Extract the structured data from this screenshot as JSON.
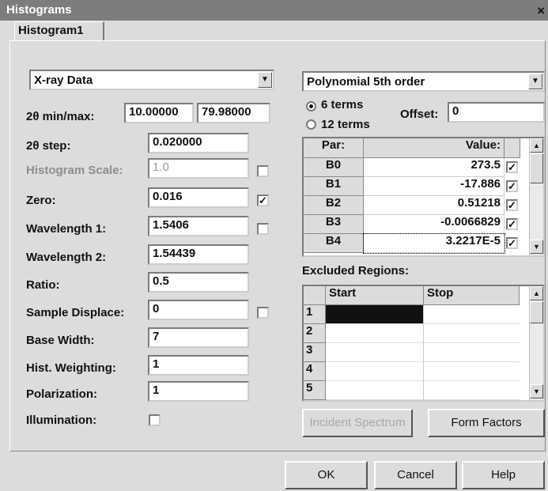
{
  "window": {
    "title": "Histograms",
    "close": "×"
  },
  "tabs": [
    "Histogram1"
  ],
  "data_type": {
    "value": "X-ray Data"
  },
  "background": {
    "value": "Polynomial 5th order"
  },
  "terms": {
    "opt1": "6 terms",
    "opt2": "12 terms",
    "selected": "6 terms"
  },
  "offset": {
    "label": "Offset:",
    "value": "0"
  },
  "theta": {
    "minmax_label": "2θ min/max:",
    "min": "10.00000",
    "max": "79.98000",
    "step_label": "2θ step:",
    "step": "0.020000"
  },
  "params": [
    {
      "label": "Histogram Scale:",
      "value": "1.0",
      "disabled": true,
      "check": false
    },
    {
      "label": "Zero:",
      "value": "0.016",
      "check": true
    },
    {
      "label": "Wavelength 1:",
      "value": "1.5406",
      "check": false
    },
    {
      "label": "Wavelength 2:",
      "value": "1.54439"
    },
    {
      "label": "Ratio:",
      "value": "0.5"
    },
    {
      "label": "Sample Displace:",
      "value": "0",
      "check": false
    },
    {
      "label": "Base Width:",
      "value": "7"
    },
    {
      "label": "Hist. Weighting:",
      "value": "1"
    },
    {
      "label": "Polarization:",
      "value": "1"
    }
  ],
  "illumination": {
    "label": "Illumination:",
    "checked": false
  },
  "coef_table": {
    "headers": [
      "Par:",
      "Value:"
    ],
    "rows": [
      {
        "par": "B0",
        "value": "273.5",
        "check": true
      },
      {
        "par": "B1",
        "value": "-17.886",
        "check": true
      },
      {
        "par": "B2",
        "value": "0.51218",
        "check": true
      },
      {
        "par": "B3",
        "value": "-0.0066829",
        "check": true
      },
      {
        "par": "B4",
        "value": "3.2217E-5",
        "check": true
      }
    ]
  },
  "excluded": {
    "label": "Excluded Regions:",
    "headers": [
      "Start",
      "Stop"
    ],
    "rows": [
      "1",
      "2",
      "3",
      "4",
      "5"
    ]
  },
  "buttons": {
    "incident": "Incident Spectrum",
    "form_factors": "Form Factors",
    "ok": "OK",
    "cancel": "Cancel",
    "help": "Help"
  },
  "icons": {
    "close": "close-icon",
    "dropdown": "chevron-down-icon",
    "check": "check-icon"
  }
}
